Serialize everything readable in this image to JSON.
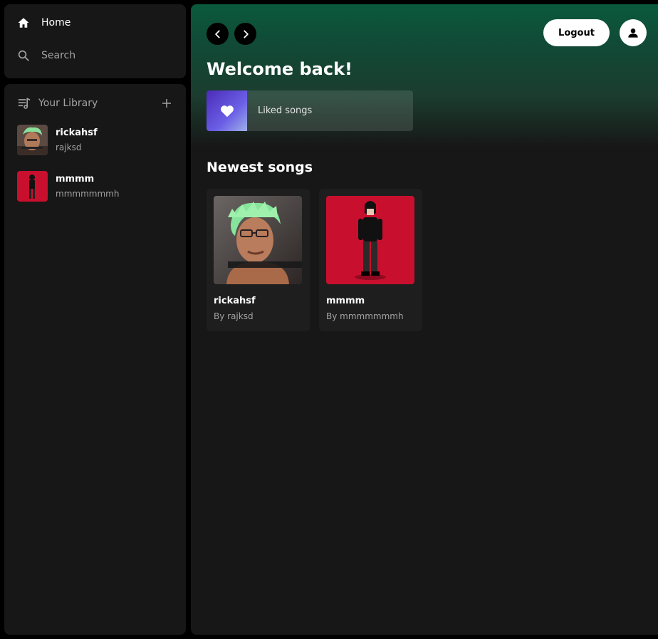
{
  "sidebar": {
    "nav": {
      "home": "Home",
      "search": "Search"
    },
    "library": {
      "title": "Your Library",
      "items": [
        {
          "title": "rickahsf",
          "subtitle": "rajksd"
        },
        {
          "title": "mmmm",
          "subtitle": "mmmmmmmh"
        }
      ]
    }
  },
  "header": {
    "logout_label": "Logout"
  },
  "main": {
    "welcome": "Welcome back!",
    "liked_label": "Liked songs",
    "section_title": "Newest songs",
    "songs": [
      {
        "title": "rickahsf",
        "byline": "By rajksd"
      },
      {
        "title": "mmmm",
        "byline": "By mmmmmmmh"
      }
    ]
  },
  "colors": {
    "accent": "#0a5a3c",
    "panel": "#171717",
    "art_red": "#c8102e",
    "liked_gradient_start": "#4b2bb8"
  }
}
